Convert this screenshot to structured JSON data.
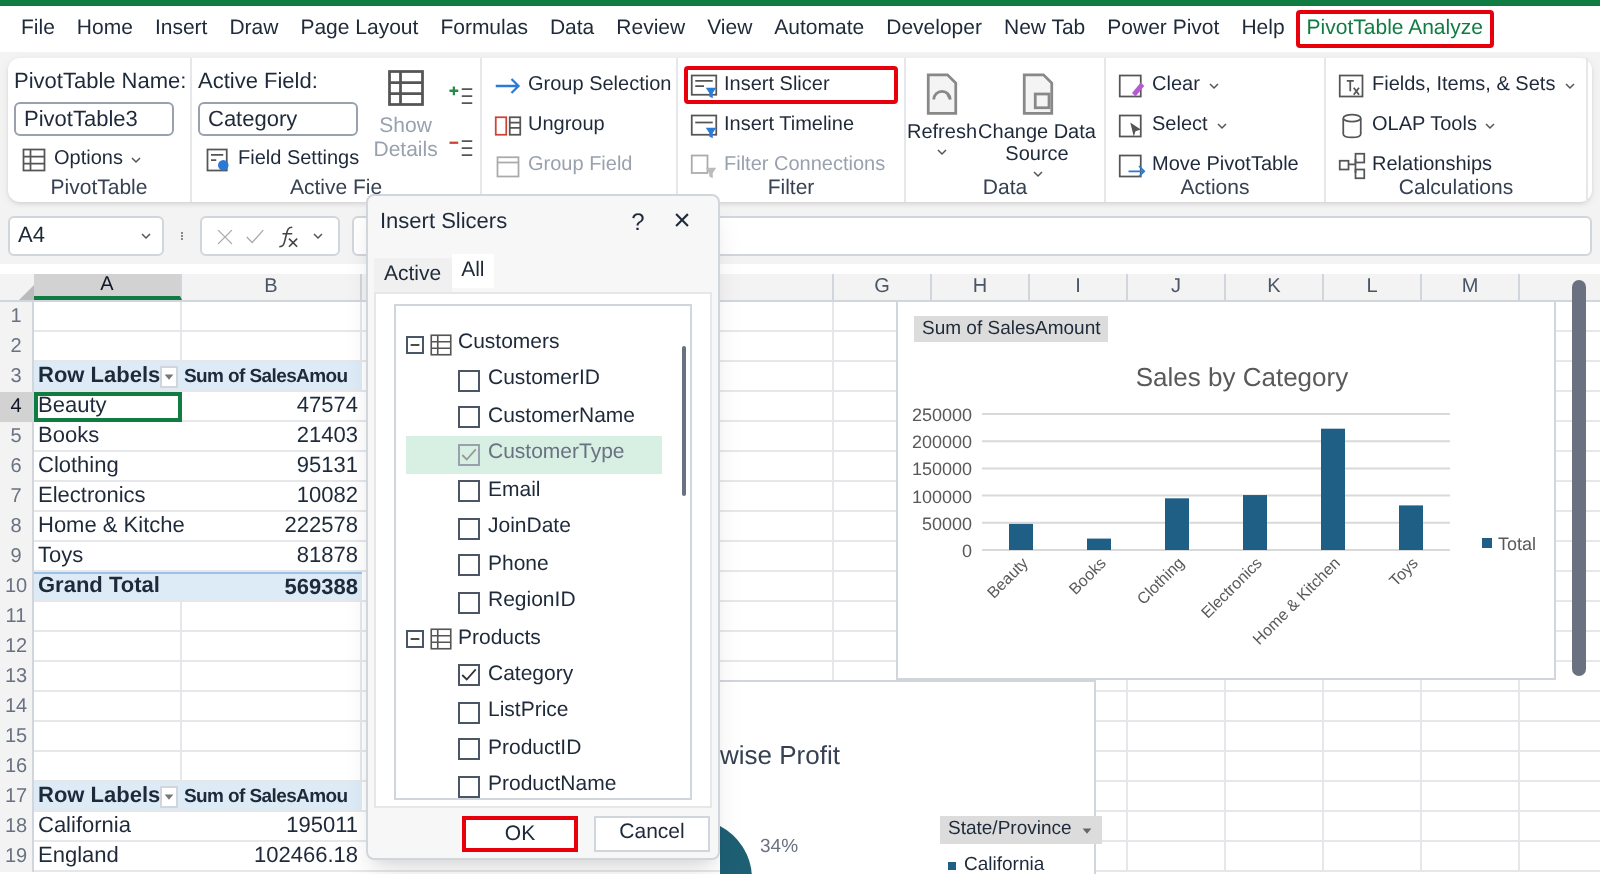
{
  "menu_tabs": [
    {
      "label": "File",
      "selected": false,
      "highlighted": false
    },
    {
      "label": "Home",
      "selected": false,
      "highlighted": false
    },
    {
      "label": "Insert",
      "selected": false,
      "highlighted": false
    },
    {
      "label": "Draw",
      "selected": false,
      "highlighted": false
    },
    {
      "label": "Page Layout",
      "selected": false,
      "highlighted": false
    },
    {
      "label": "Formulas",
      "selected": false,
      "highlighted": false
    },
    {
      "label": "Data",
      "selected": false,
      "highlighted": false
    },
    {
      "label": "Review",
      "selected": false,
      "highlighted": false
    },
    {
      "label": "View",
      "selected": false,
      "highlighted": false
    },
    {
      "label": "Automate",
      "selected": false,
      "highlighted": false
    },
    {
      "label": "Developer",
      "selected": false,
      "highlighted": false
    },
    {
      "label": "New Tab",
      "selected": false,
      "highlighted": false
    },
    {
      "label": "Power Pivot",
      "selected": false,
      "highlighted": false
    },
    {
      "label": "Help",
      "selected": false,
      "highlighted": false
    },
    {
      "label": "PivotTable Analyze",
      "selected": true,
      "highlighted": true
    }
  ],
  "ribbon": [
    {
      "kind": "name_field",
      "label": "PivotTable",
      "field_label": "PivotTable Name:",
      "field_value": "PivotTable3",
      "buttons": [
        {
          "label": "Options",
          "dropdown": true,
          "disabled": false,
          "highlighted": false
        }
      ]
    },
    {
      "kind": "name_field",
      "label": "Active Fie",
      "field_label": "Active Field:",
      "field_value": "Category",
      "buttons": [
        {
          "label": "Field Settings",
          "dropdown": false,
          "disabled": false,
          "highlighted": false
        }
      ],
      "big_button": {
        "label": "Show Details",
        "disabled": true
      }
    },
    {
      "kind": "list",
      "buttons": [
        {
          "label": "Group Selection",
          "dropdown": false,
          "disabled": false,
          "highlighted": false
        },
        {
          "label": "Ungroup",
          "dropdown": false,
          "disabled": false,
          "highlighted": false
        },
        {
          "label": "Group Field",
          "dropdown": false,
          "disabled": true,
          "highlighted": false
        }
      ]
    },
    {
      "kind": "list",
      "label": "Filter",
      "buttons": [
        {
          "label": "Insert Slicer",
          "dropdown": false,
          "disabled": false,
          "highlighted": true
        },
        {
          "label": "Insert Timeline",
          "dropdown": false,
          "disabled": false,
          "highlighted": false
        },
        {
          "label": "Filter Connections",
          "dropdown": false,
          "disabled": true,
          "highlighted": false
        }
      ]
    },
    {
      "kind": "big",
      "label": "Data",
      "buttons": [
        {
          "label": "Refresh",
          "dropdown": true,
          "disabled": false,
          "highlighted": false
        },
        {
          "label": "Change Data Source",
          "dropdown": true,
          "disabled": false,
          "highlighted": false
        }
      ]
    },
    {
      "kind": "list",
      "label": "Actions",
      "buttons": [
        {
          "label": "Clear",
          "dropdown": true,
          "disabled": false,
          "highlighted": false
        },
        {
          "label": "Select",
          "dropdown": true,
          "disabled": false,
          "highlighted": false
        },
        {
          "label": "Move PivotTable",
          "dropdown": false,
          "disabled": false,
          "highlighted": false
        }
      ]
    },
    {
      "kind": "list",
      "label": "Calculations",
      "buttons": [
        {
          "label": "Fields, Items, & Sets",
          "dropdown": true,
          "disabled": false,
          "highlighted": false
        },
        {
          "label": "OLAP Tools",
          "dropdown": true,
          "disabled": false,
          "highlighted": false
        },
        {
          "label": "Relationships",
          "dropdown": false,
          "disabled": false,
          "highlighted": false
        }
      ]
    }
  ],
  "formula_bar": {
    "name_box": "A4"
  },
  "sheet": {
    "columns": [
      {
        "label": "A",
        "selected": true
      },
      {
        "label": "B",
        "selected": false
      },
      {
        "label": "G",
        "selected": false
      },
      {
        "label": "H",
        "selected": false
      },
      {
        "label": "I",
        "selected": false
      },
      {
        "label": "J",
        "selected": false
      },
      {
        "label": "K",
        "selected": false
      },
      {
        "label": "L",
        "selected": false
      },
      {
        "label": "M",
        "selected": false
      }
    ],
    "rows": [
      {
        "number": "1",
        "kind": "blank",
        "selected": false
      },
      {
        "number": "2",
        "kind": "blank",
        "selected": false
      },
      {
        "number": "3",
        "kind": "header",
        "label": "Row Labels",
        "value": "Sum of SalesAmou",
        "selected": false
      },
      {
        "number": "4",
        "kind": "item",
        "label": "Beauty",
        "value": "47574",
        "selected": true
      },
      {
        "number": "5",
        "kind": "item",
        "label": "Books",
        "value": "21403",
        "selected": false
      },
      {
        "number": "6",
        "kind": "item",
        "label": "Clothing",
        "value": "95131",
        "selected": false
      },
      {
        "number": "7",
        "kind": "item",
        "label": "Electronics",
        "value": "10082",
        "selected": false
      },
      {
        "number": "8",
        "kind": "item",
        "label": "Home & Kitche",
        "value": "222578",
        "selected": false
      },
      {
        "number": "9",
        "kind": "item",
        "label": "Toys",
        "value": "81878",
        "selected": false
      },
      {
        "number": "10",
        "kind": "total",
        "label": "Grand Total",
        "value": "569388",
        "selected": false
      },
      {
        "number": "11",
        "kind": "blank",
        "selected": false
      },
      {
        "number": "12",
        "kind": "blank",
        "selected": false
      },
      {
        "number": "13",
        "kind": "blank",
        "selected": false
      },
      {
        "number": "14",
        "kind": "blank",
        "selected": false
      },
      {
        "number": "15",
        "kind": "blank",
        "selected": false
      },
      {
        "number": "16",
        "kind": "blank",
        "selected": false
      },
      {
        "number": "17",
        "kind": "header",
        "label": "Row Labels",
        "value": "Sum of SalesAmou",
        "selected": false
      },
      {
        "number": "18",
        "kind": "item",
        "label": "California",
        "value": "195011",
        "selected": false
      },
      {
        "number": "19",
        "kind": "item",
        "label": "England",
        "value": "102466.18",
        "selected": false
      }
    ]
  },
  "sales_chart": {
    "field_button": "Sum of SalesAmount",
    "chart_data": {
      "type": "bar",
      "title": "Sales by Category",
      "grid": true,
      "categories": [
        "Beauty",
        "Books",
        "Clothing",
        "Electronics",
        "Home & Kitchen",
        "Toys"
      ],
      "series": [
        {
          "name": "Total",
          "color": "#1f5f85",
          "values": [
            48000,
            21000,
            95000,
            101000,
            223000,
            82000
          ]
        }
      ],
      "ylim": [
        0,
        250000
      ],
      "yticks": [
        0,
        50000,
        100000,
        150000,
        200000,
        250000
      ]
    }
  },
  "profit_chart": {
    "title": "wise Profit",
    "data_label": "34%",
    "field_button": "State/Province",
    "legend": [
      {
        "label": "California",
        "color": "#1f5f85"
      }
    ]
  },
  "dialog": {
    "title": "Insert Slicers",
    "help": "?",
    "close": "×",
    "tabs": [
      {
        "label": "Active",
        "selected": false
      },
      {
        "label": "All",
        "selected": true
      }
    ],
    "tree": [
      {
        "label": "Customers",
        "expanded": true,
        "children": [
          {
            "label": "CustomerID",
            "checked": false,
            "disabled": false,
            "selected": false
          },
          {
            "label": "CustomerName",
            "checked": false,
            "disabled": false,
            "selected": false
          },
          {
            "label": "CustomerType",
            "checked": true,
            "disabled": true,
            "selected": true
          },
          {
            "label": "Email",
            "checked": false,
            "disabled": false,
            "selected": false
          },
          {
            "label": "JoinDate",
            "checked": false,
            "disabled": false,
            "selected": false
          },
          {
            "label": "Phone",
            "checked": false,
            "disabled": false,
            "selected": false
          },
          {
            "label": "RegionID",
            "checked": false,
            "disabled": false,
            "selected": false
          }
        ]
      },
      {
        "label": "Products",
        "expanded": true,
        "children": [
          {
            "label": "Category",
            "checked": true,
            "disabled": false,
            "selected": false
          },
          {
            "label": "ListPrice",
            "checked": false,
            "disabled": false,
            "selected": false
          },
          {
            "label": "ProductID",
            "checked": false,
            "disabled": false,
            "selected": false
          },
          {
            "label": "ProductName",
            "checked": false,
            "disabled": false,
            "selected": false
          }
        ]
      }
    ],
    "buttons": [
      {
        "label": "OK",
        "highlighted": true
      },
      {
        "label": "Cancel",
        "highlighted": false
      }
    ]
  }
}
